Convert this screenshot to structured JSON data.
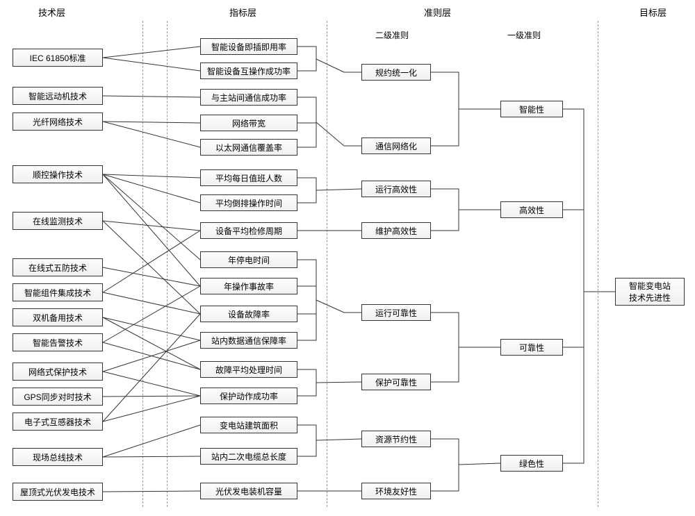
{
  "headers": {
    "tech": "技术层",
    "indicator": "指标层",
    "criteria": "准则层",
    "goal": "目标层",
    "sub_l2": "二级准则",
    "sub_l1": "一级准则"
  },
  "tech": [
    "IEC 61850标准",
    "智能远动机技术",
    "光纤网络技术",
    "顺控操作技术",
    "在线监测技术",
    "在线式五防技术",
    "智能组件集成技术",
    "双机备用技术",
    "智能告警技术",
    "网络式保护技术",
    "GPS同步对时技术",
    "电子式互感器技术",
    "现场总线技术",
    "屋顶式光伏发电技术"
  ],
  "indicator": [
    "智能设备即插即用率",
    "智能设备互操作成功率",
    "与主站间通信成功率",
    "网络带宽",
    "以太网通信覆盖率",
    "平均每日值班人数",
    "平均倒排操作时间",
    "设备平均检修周期",
    "年停电时间",
    "年操作事故率",
    "设备故障率",
    "站内数据通信保障率",
    "故障平均处理时间",
    "保护动作成功率",
    "变电站建筑面积",
    "站内二次电缆总长度",
    "光伏发电装机容量"
  ],
  "criteria2": [
    "规约统一化",
    "通信网络化",
    "运行高效性",
    "维护高效性",
    "运行可靠性",
    "保护可靠性",
    "资源节约性",
    "环境友好性"
  ],
  "criteria1": [
    "智能性",
    "高效性",
    "可靠性",
    "绿色性"
  ],
  "goal": "智能变电站\n技术先进性",
  "chart_data": {
    "type": "hierarchy-diagram",
    "layers": [
      "技术层",
      "指标层",
      "准则层-二级",
      "准则层-一级",
      "目标层"
    ],
    "edges_tech_to_indicator": [
      [
        0,
        0
      ],
      [
        0,
        1
      ],
      [
        1,
        2
      ],
      [
        2,
        3
      ],
      [
        2,
        4
      ],
      [
        3,
        5
      ],
      [
        3,
        6
      ],
      [
        3,
        8
      ],
      [
        3,
        9
      ],
      [
        4,
        7
      ],
      [
        4,
        10
      ],
      [
        5,
        9
      ],
      [
        6,
        7
      ],
      [
        6,
        10
      ],
      [
        7,
        11
      ],
      [
        7,
        12
      ],
      [
        8,
        9
      ],
      [
        8,
        12
      ],
      [
        9,
        11
      ],
      [
        9,
        13
      ],
      [
        10,
        13
      ],
      [
        11,
        13
      ],
      [
        11,
        10
      ],
      [
        12,
        14
      ],
      [
        12,
        15
      ],
      [
        13,
        16
      ]
    ],
    "edges_indicator_to_c2": [
      [
        0,
        0
      ],
      [
        1,
        0
      ],
      [
        2,
        1
      ],
      [
        3,
        1
      ],
      [
        4,
        1
      ],
      [
        5,
        2
      ],
      [
        6,
        2
      ],
      [
        7,
        3
      ],
      [
        8,
        4
      ],
      [
        9,
        4
      ],
      [
        10,
        4
      ],
      [
        11,
        4
      ],
      [
        12,
        5
      ],
      [
        13,
        5
      ],
      [
        14,
        6
      ],
      [
        15,
        6
      ],
      [
        16,
        7
      ]
    ],
    "edges_c2_to_c1": [
      [
        0,
        0
      ],
      [
        1,
        0
      ],
      [
        2,
        1
      ],
      [
        3,
        1
      ],
      [
        4,
        2
      ],
      [
        5,
        2
      ],
      [
        6,
        3
      ],
      [
        7,
        3
      ]
    ],
    "edges_c1_to_goal": [
      0,
      1,
      2,
      3
    ]
  }
}
